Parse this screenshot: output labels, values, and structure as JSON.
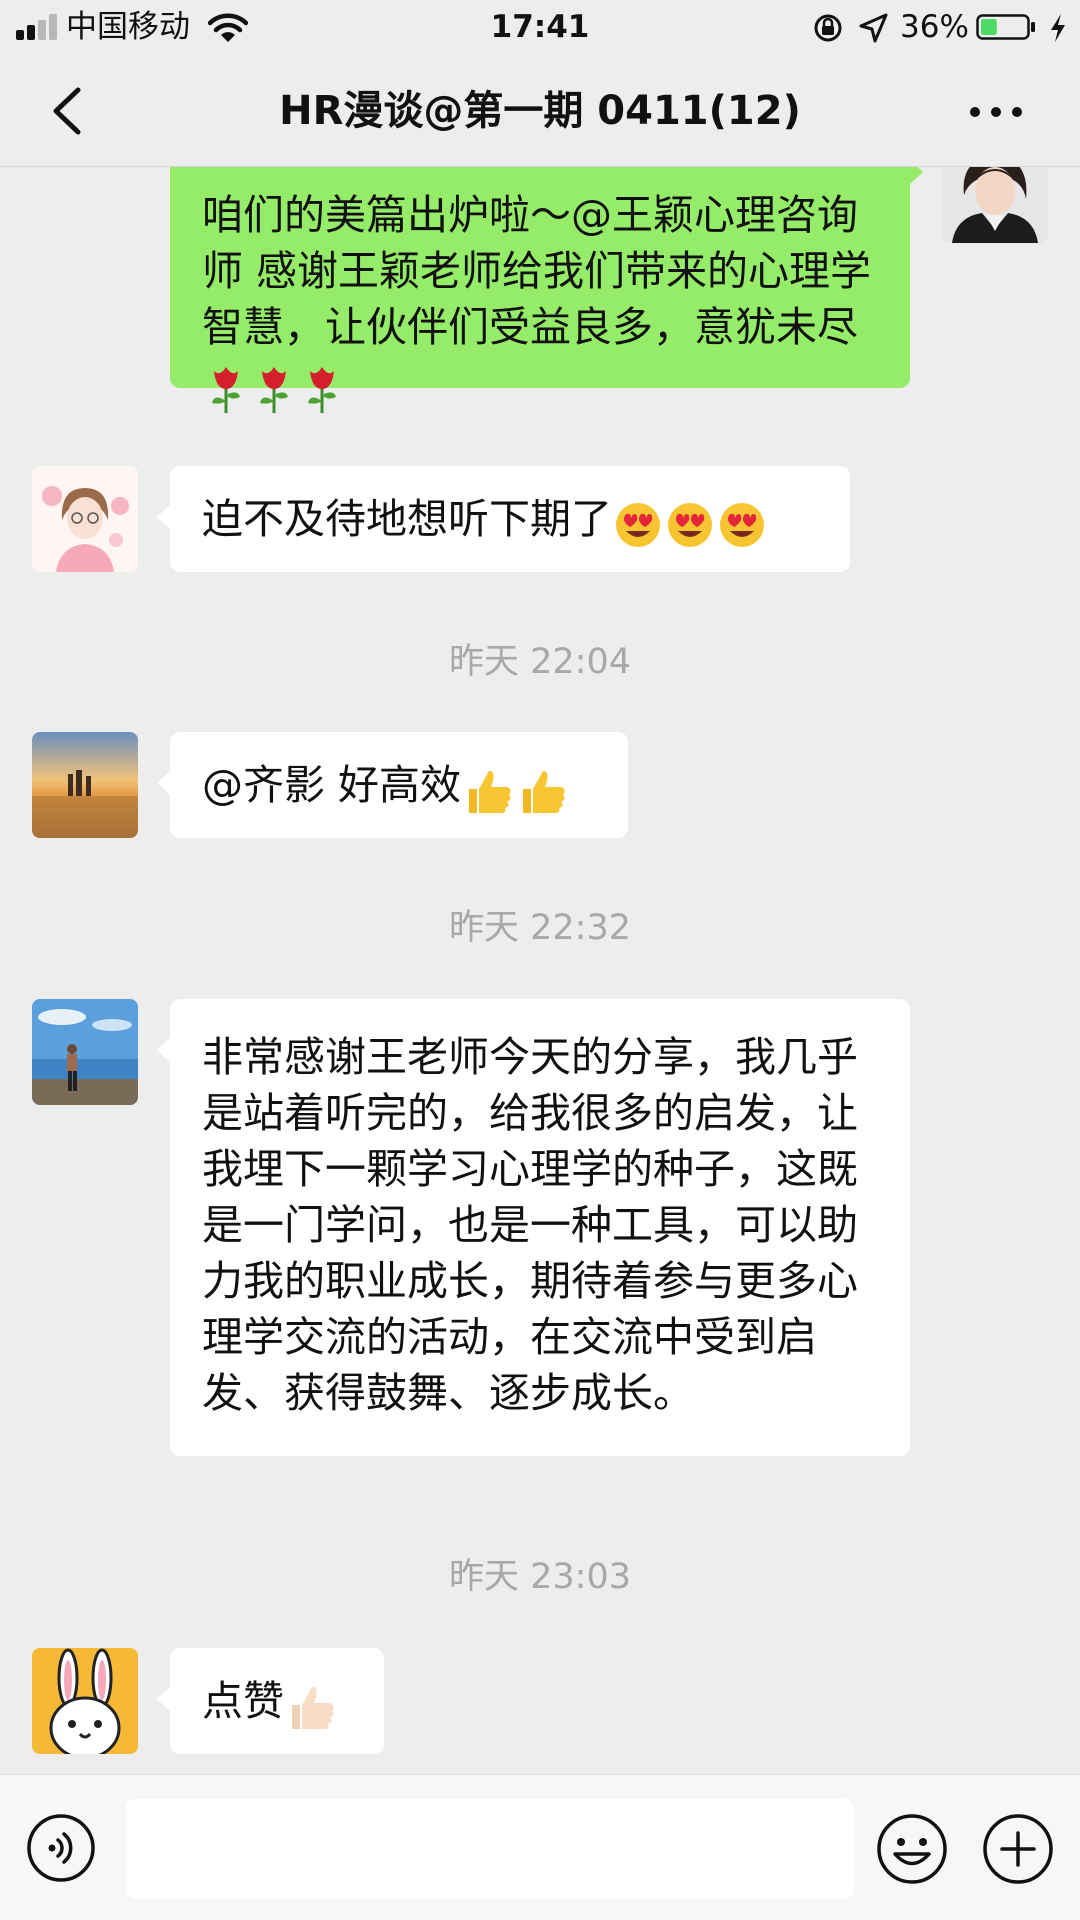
{
  "status_bar": {
    "carrier": "中国移动",
    "time": "17:41",
    "battery_percent": "36%",
    "battery_level": 0.36,
    "signal_bars": 2
  },
  "nav": {
    "title": "HR漫谈@第一期 0411(12)",
    "back_icon": "chevron-left-icon",
    "more_icon": "more-dots-icon"
  },
  "messages": [
    {
      "side": "right",
      "text": "咱们的美篇出炉啦～@王颖心理咨询师 感谢王颖老师给我们带来的心理学智慧，让伙伴们受益良多，意犹未尽",
      "emoji": [
        "rose",
        "rose",
        "rose"
      ]
    },
    {
      "side": "left",
      "text": "迫不及待地想听下期了",
      "emoji": [
        "heart-eyes",
        "heart-eyes",
        "heart-eyes"
      ]
    },
    {
      "timestamp": "昨天 22:04"
    },
    {
      "side": "left",
      "text": "@齐影 好高效",
      "emoji": [
        "thumbs-up",
        "thumbs-up"
      ]
    },
    {
      "timestamp": "昨天 22:32"
    },
    {
      "side": "left",
      "text": "非常感谢王老师今天的分享，我几乎是站着听完的，给我很多的启发，让我埋下一颗学习心理学的种子，这既是一门学问，也是一种工具，可以助力我的职业成长，期待着参与更多心理学交流的活动，在交流中受到启发、获得鼓舞、逐步成长。",
      "emoji": []
    },
    {
      "timestamp": "昨天 23:03"
    },
    {
      "side": "left",
      "text": "点赞",
      "emoji": [
        "thumbs-up-light"
      ]
    }
  ],
  "input_bar": {
    "voice_icon": "voice-icon",
    "emoji_icon": "emoji-face-icon",
    "plus_icon": "plus-circle-icon",
    "value": ""
  },
  "colors": {
    "background": "#ededed",
    "own_bubble": "#95ec69",
    "other_bubble": "#ffffff",
    "timestamp": "#a8a8a8",
    "battery_fill": "#4cd964"
  }
}
